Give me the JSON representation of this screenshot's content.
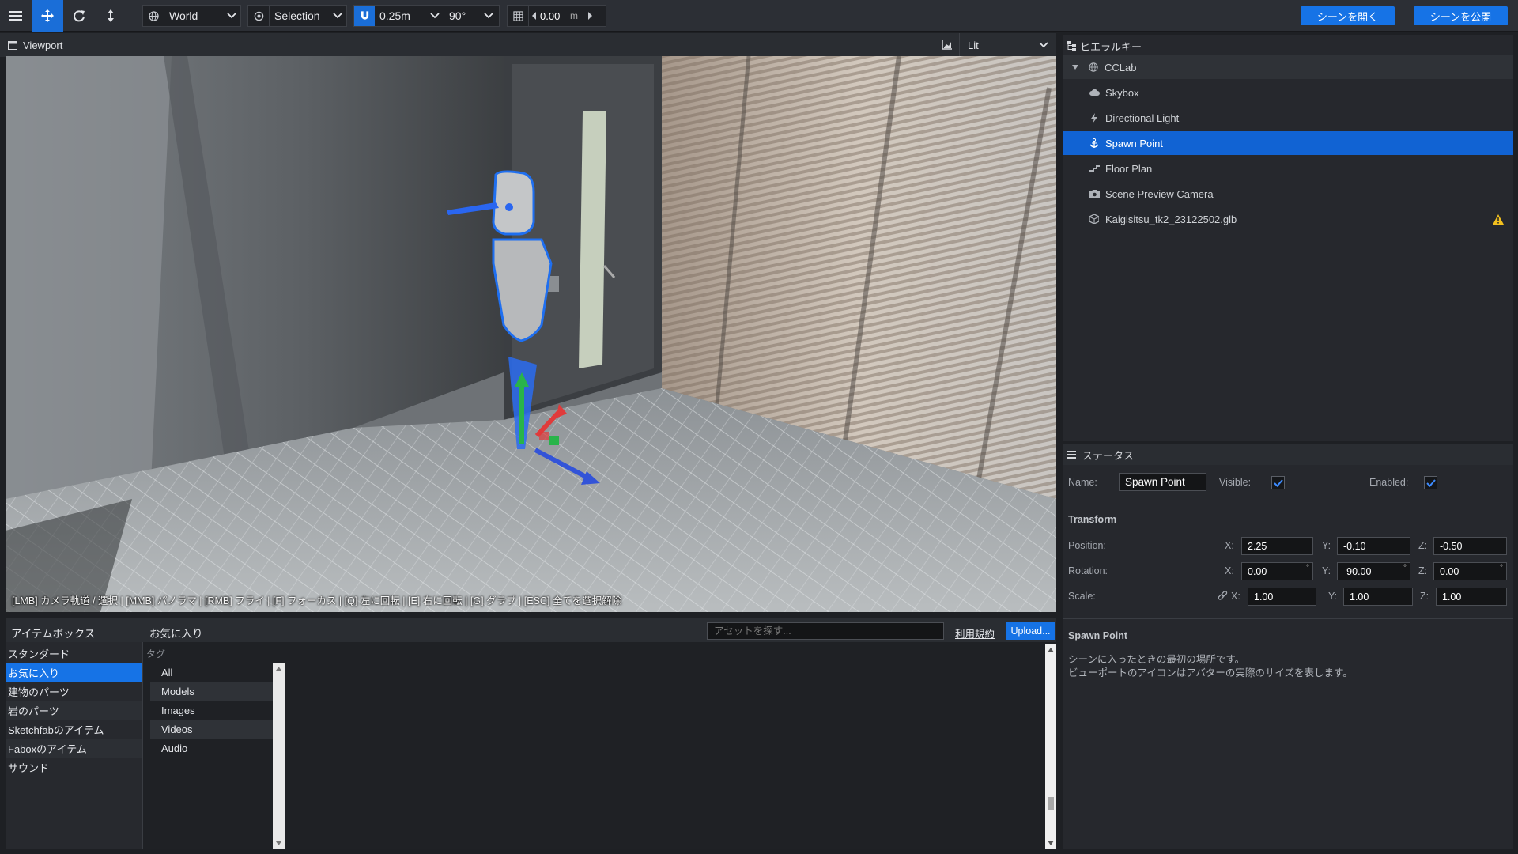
{
  "toolbar": {
    "space": "World",
    "mode": "Selection",
    "snap_distance": "0.25m",
    "snap_angle": "90°",
    "grid_value": "0.00",
    "grid_unit": "m",
    "open_scene": "シーンを開く",
    "publish_scene": "シーンを公開"
  },
  "viewport": {
    "title": "Viewport",
    "render_mode": "Lit",
    "hint": "[LMB] カメラ軌道 / 選択 | [MMB] パノラマ | [RMB] フライ | [F] フォーカス | [Q] 左に回転 | [E] 右に回転 | [G] グラブ | [ESC] 全てを選択解除"
  },
  "hierarchy": {
    "title": "ヒエラルキー",
    "root": "CCLab",
    "items": [
      {
        "label": "Skybox",
        "icon": "cloud-icon"
      },
      {
        "label": "Directional Light",
        "icon": "lightning-icon"
      },
      {
        "label": "Spawn Point",
        "icon": "anchor-icon"
      },
      {
        "label": "Floor Plan",
        "icon": "stairs-icon"
      },
      {
        "label": "Scene Preview Camera",
        "icon": "camera-icon"
      },
      {
        "label": "Kaigisitsu_tk2_23122502.glb",
        "icon": "cube-icon"
      }
    ]
  },
  "status": {
    "title": "ステータス",
    "name_label": "Name:",
    "name_value": "Spawn Point",
    "visible_label": "Visible:",
    "enabled_label": "Enabled:",
    "visible": true,
    "enabled": true,
    "transform_title": "Transform",
    "position_label": "Position:",
    "rotation_label": "Rotation:",
    "scale_label": "Scale:",
    "x_label": "X:",
    "y_label": "Y:",
    "z_label": "Z:",
    "position": {
      "x": "2.25",
      "y": "-0.10",
      "z": "-0.50"
    },
    "rotation": {
      "x": "0.00",
      "y": "-90.00",
      "z": "0.00"
    },
    "scale": {
      "x": "1.00",
      "y": "1.00",
      "z": "1.00"
    },
    "degree_symbol": "°",
    "description_title": "Spawn Point",
    "description_line1": "シーンに入ったときの最初の場所です。",
    "description_line2": "ビューポートのアイコンはアバターの実際のサイズを表します。"
  },
  "itembox": {
    "title": "アイテムボックス",
    "section": "お気に入り",
    "search_placeholder": "アセットを探す...",
    "terms": "利用規約",
    "upload": "Upload...",
    "tag_header": "タグ",
    "categories": [
      "スタンダード",
      "お気に入り",
      "建物のパーツ",
      "岩のパーツ",
      "Sketchfabのアイテム",
      "Faboxのアイテム",
      "サウンド"
    ],
    "tags": [
      "All",
      "Models",
      "Images",
      "Videos",
      "Audio"
    ]
  },
  "colors": {
    "accent": "#1673e6",
    "selection": "#1163d3",
    "warning": "#f2c01e"
  }
}
